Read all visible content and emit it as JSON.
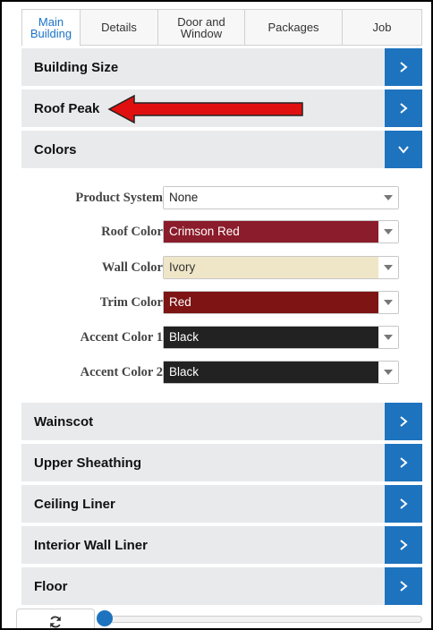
{
  "tabs": [
    {
      "label": "Main\nBuilding",
      "active": true
    },
    {
      "label": "Details",
      "active": false
    },
    {
      "label": "Door and\nWindow",
      "active": false
    },
    {
      "label": "Packages",
      "active": false
    },
    {
      "label": "Job",
      "active": false
    }
  ],
  "sections": {
    "building_size": "Building Size",
    "roof_peak": "Roof Peak",
    "colors": "Colors",
    "wainscot": "Wainscot",
    "upper_sheathing": "Upper Sheathing",
    "ceiling_liner": "Ceiling Liner",
    "interior_wall_liner": "Interior Wall Liner",
    "floor": "Floor"
  },
  "colors_form": {
    "product_system": {
      "label": "Product System",
      "value": "None",
      "bg": "#ffffff",
      "fg": "#222222"
    },
    "roof_color": {
      "label": "Roof Color",
      "value": "Crimson Red",
      "bg": "#8b1c2b",
      "fg": "#ffffff"
    },
    "wall_color": {
      "label": "Wall Color",
      "value": "Ivory",
      "bg": "#efe6c8",
      "fg": "#333333"
    },
    "trim_color": {
      "label": "Trim Color",
      "value": "Red",
      "bg": "#7e1414",
      "fg": "#ffffff"
    },
    "accent_color_1": {
      "label": "Accent Color 1",
      "value": "Black",
      "bg": "#222222",
      "fg": "#ffffff"
    },
    "accent_color_2": {
      "label": "Accent Color 2",
      "value": "Black",
      "bg": "#222222",
      "fg": "#ffffff"
    }
  },
  "icons": {
    "expand": "chevron-right-icon",
    "collapse": "chevron-down-icon",
    "select": "caret-down-icon",
    "refresh": "refresh-icon",
    "annotation": "red-arrow-icon"
  },
  "colors": {
    "accent": "#1e73be",
    "row_bg": "#e9eaec",
    "active_tab": "#1a73c8",
    "annotation": "#e01010"
  },
  "slider": {
    "value": 0
  }
}
